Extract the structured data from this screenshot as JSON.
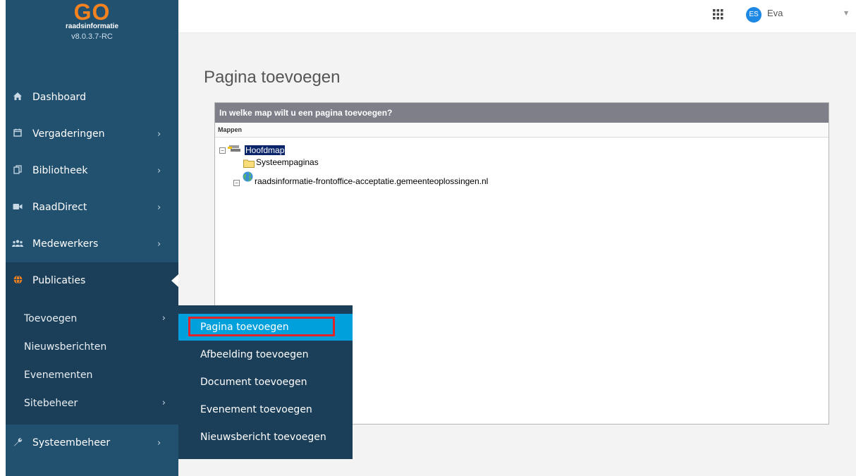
{
  "logo": {
    "brand": "GO",
    "subtitle": "raadsinformatie",
    "version": "v8.0.3.7-RC"
  },
  "sidebar": {
    "items": [
      {
        "label": "Dashboard",
        "icon": "home-icon",
        "has_chevron": false
      },
      {
        "label": "Vergaderingen",
        "icon": "calendar-icon",
        "has_chevron": true
      },
      {
        "label": "Bibliotheek",
        "icon": "copy-icon",
        "has_chevron": true
      },
      {
        "label": "RaadDirect",
        "icon": "video-camera-icon",
        "has_chevron": true
      },
      {
        "label": "Medewerkers",
        "icon": "users-icon",
        "has_chevron": true
      },
      {
        "label": "Publicaties",
        "icon": "globe-icon",
        "has_chevron": false,
        "active": true
      },
      {
        "label": "Systeembeheer",
        "icon": "wrench-icon",
        "has_chevron": true
      }
    ],
    "submenu": [
      {
        "label": "Toevoegen",
        "has_chevron": true
      },
      {
        "label": "Nieuwsberichten",
        "has_chevron": false
      },
      {
        "label": "Evenementen",
        "has_chevron": false
      },
      {
        "label": "Sitebeheer",
        "has_chevron": true
      }
    ]
  },
  "topbar": {
    "apps_icon": "grid-icon",
    "avatar_initials": "ES",
    "username": "Eva"
  },
  "page": {
    "title": "Pagina toevoegen"
  },
  "panel": {
    "header": "In welke map wilt u een pagina toevoegen?",
    "column_header": "Mappen",
    "tree": {
      "root": "Hoofdmap",
      "children": [
        "Systeempaginas"
      ],
      "site": "raadsinformatie-frontoffice-acceptatie.gemeenteoplossingen.nl"
    }
  },
  "dropdown": {
    "items": [
      "Pagina toevoegen",
      "Afbeelding toevoegen",
      "Document toevoegen",
      "Evenement toevoegen",
      "Nieuwsbericht toevoegen"
    ],
    "active": "Pagina toevoegen"
  },
  "colors": {
    "sidebar": "#22506f",
    "sidebar_active": "#1b3f59",
    "accent": "#00a0dc",
    "highlight": "#e0242c",
    "logo": "#f4821f"
  }
}
